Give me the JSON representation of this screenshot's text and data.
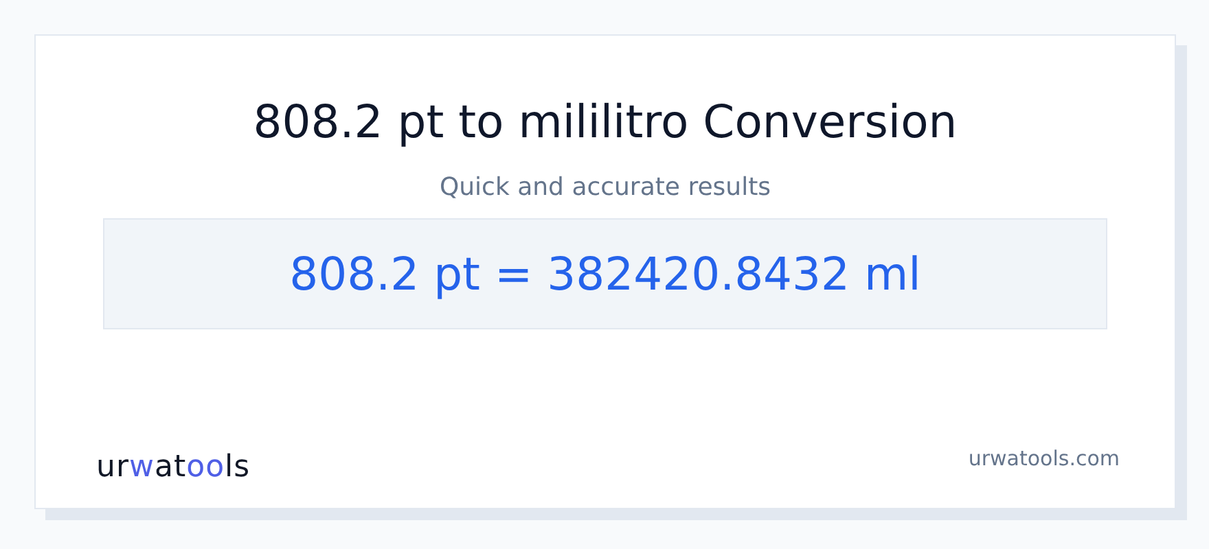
{
  "title": "808.2 pt to mililitro Conversion",
  "subtitle": "Quick and accurate results",
  "result": "808.2 pt = 382420.8432 ml",
  "logo": [
    {
      "text": "ur",
      "accent": false
    },
    {
      "text": "w",
      "accent": true
    },
    {
      "text": "at",
      "accent": false
    },
    {
      "text": "oo",
      "accent": true
    },
    {
      "text": "ls",
      "accent": false
    }
  ],
  "site": "urwatools.com"
}
